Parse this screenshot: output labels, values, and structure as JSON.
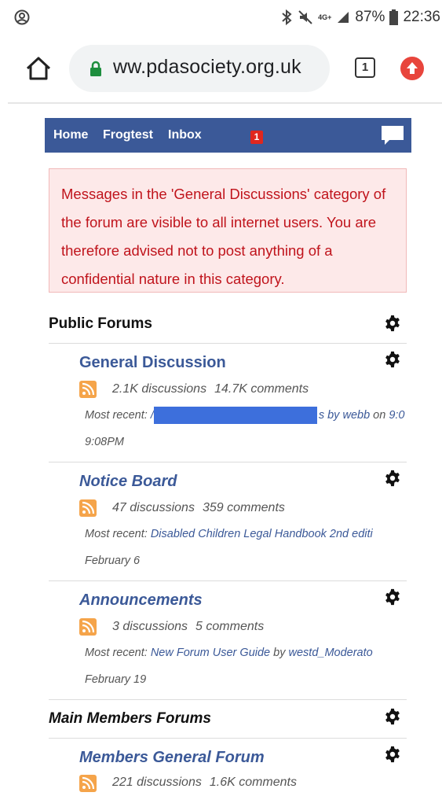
{
  "status": {
    "signal": "4G+",
    "battery": "87%",
    "time": "22:36"
  },
  "browser": {
    "url": "ww.pdasociety.org.uk",
    "tab_count": "1"
  },
  "nav": {
    "home": "Home",
    "frogtest": "Frogtest",
    "inbox": "Inbox",
    "inbox_badge": "1"
  },
  "warning": "Messages in the 'General Discussions' category of the forum are visible to all internet users. You are therefore advised not to post anything of a confidential nature in this category.",
  "sections": {
    "public": "Public Forums",
    "members": "Main Members Forums"
  },
  "forums": [
    {
      "title": "General Discussion",
      "discussions": "2.1K discussions",
      "comments": "14.7K comments",
      "recent_prefix": "Most recent:",
      "recent_title": "/",
      "recent_by": "s by",
      "recent_user": "webb",
      "recent_on": "on",
      "recent_time": "9:0",
      "date": "9:08PM"
    },
    {
      "title": "Notice Board",
      "discussions": "47 discussions",
      "comments": "359 comments",
      "recent_prefix": "Most recent:",
      "recent_title": "Disabled Children Legal Handbook 2nd editi",
      "date": "February 6"
    },
    {
      "title": "Announcements",
      "discussions": "3 discussions",
      "comments": "5 comments",
      "recent_prefix": "Most recent:",
      "recent_title": "New Forum User Guide",
      "recent_by": "by",
      "recent_user": "westd_Moderato",
      "date": "February 19"
    },
    {
      "title": "Members General Forum",
      "discussions": "221 discussions",
      "comments": "1.6K comments"
    }
  ],
  "colors": {
    "nav_bg": "#3b5998",
    "link": "#3b5998",
    "warning_text": "#c0141c",
    "warning_bg": "#fde9e9",
    "rss": "#f5a44a",
    "badge": "#e0271e"
  }
}
